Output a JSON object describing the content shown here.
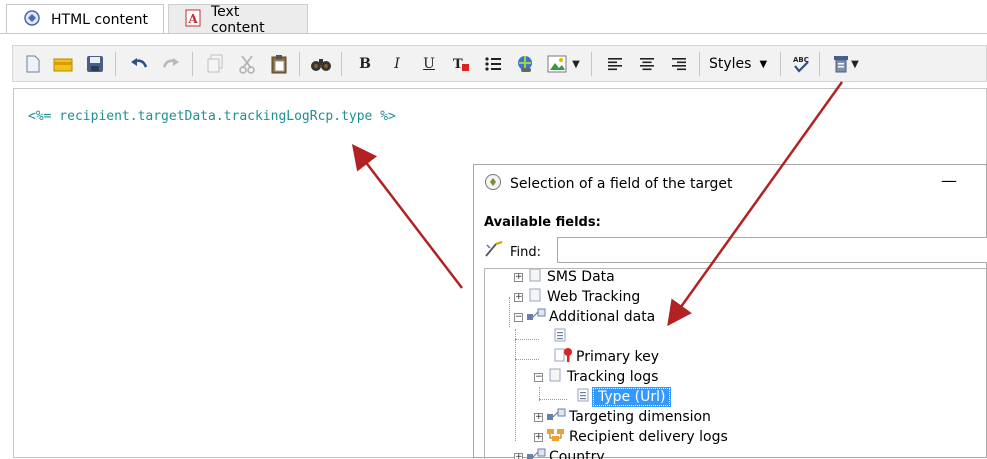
{
  "tabs": [
    {
      "label": "HTML content",
      "icon": "html-content-icon",
      "active": true
    },
    {
      "label": "Text content",
      "icon": "text-content-icon",
      "active": false
    }
  ],
  "toolbar": {
    "styles_label": "Styles",
    "buttons": [
      "new-icon",
      "open-icon",
      "save-icon",
      "undo-icon",
      "redo-icon",
      "copy-icon",
      "cut-icon",
      "paste-icon",
      "find-icon",
      "bold-icon",
      "italic-icon",
      "underline-icon",
      "clear-format-icon",
      "list-icon",
      "link-icon",
      "image-icon",
      "align-left-icon",
      "align-center-icon",
      "align-right-icon",
      "spellcheck-icon",
      "insert-field-icon"
    ],
    "bold": "B",
    "italic": "I",
    "underline": "U"
  },
  "editor": {
    "code": "<%= recipient.targetData.trackingLogRcp.type %>"
  },
  "dialog": {
    "title": "Selection of a field of the target",
    "minimize": "—",
    "available_fields_label": "Available fields:",
    "find_label": "Find:",
    "find_value": "",
    "tree": {
      "sms_data": "SMS Data",
      "web_tracking": "Web Tracking",
      "additional_data": "Additional data",
      "primary_key": "Primary key",
      "tracking_logs": "Tracking logs",
      "type_url": "Type (Url)",
      "targeting_dimension": "Targeting dimension",
      "recipient_delivery_logs": "Recipient delivery logs",
      "country": "Country"
    }
  },
  "colors": {
    "code_text": "#1f8f95",
    "selection": "#3399ff",
    "arrow": "#b22222"
  }
}
